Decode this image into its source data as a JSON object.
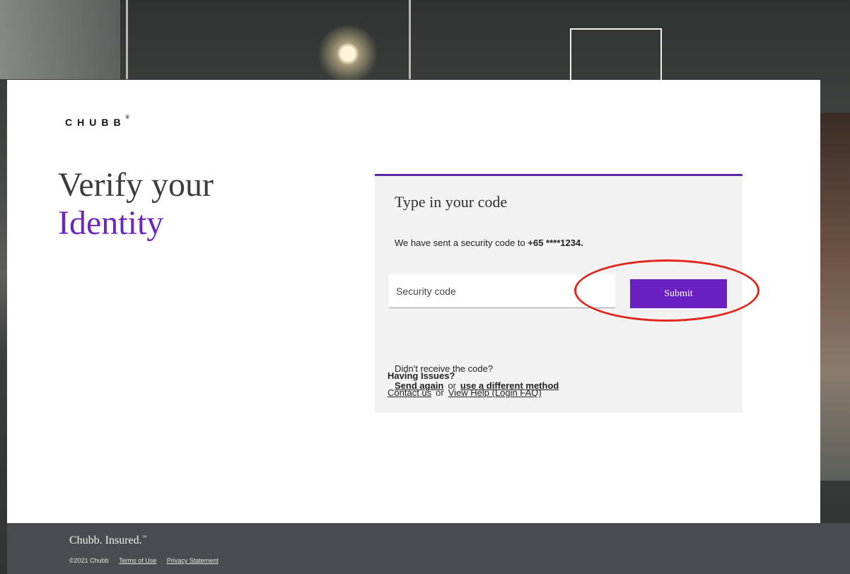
{
  "brand": {
    "logo": "CHUBB",
    "logo_mark": "®"
  },
  "hero": {
    "line1": "Verify your",
    "line2": "Identity"
  },
  "verify_panel": {
    "heading": "Type in your code",
    "sent_text": "We have sent a security code to ",
    "phone": "+65 ****1234.",
    "input_placeholder": "Security code",
    "input_value": "",
    "submit_label": "Submit",
    "resend_question": "Didn't receive the code?",
    "send_again": "Send again",
    "or": "or",
    "different_method": "use a different method"
  },
  "help": {
    "title": "Having Issues?",
    "contact": "Contact us",
    "or": "or",
    "faq": "View Help (Login FAQ)"
  },
  "footer": {
    "tagline": "Chubb. Insured.",
    "tagline_mark": "™",
    "copyright": "©2021 Chubb",
    "terms": "Terms of Use",
    "privacy": "Privacy Statement"
  },
  "colors": {
    "accent": "#6a1fc2",
    "panel_border": "#5c2aa6",
    "annotation": "#e3261d",
    "footer_bg": "#4a4c4f"
  }
}
